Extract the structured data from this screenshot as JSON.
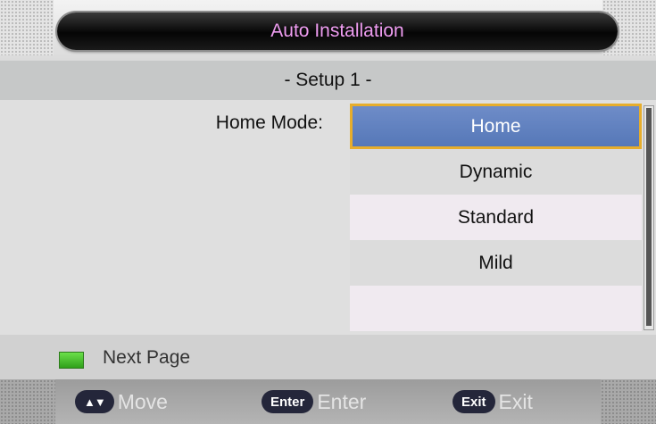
{
  "header": {
    "title": "Auto Installation"
  },
  "subtitle": "- Setup 1 -",
  "field": {
    "label": "Home Mode:"
  },
  "options": [
    {
      "label": "Home",
      "selected": true
    },
    {
      "label": "Dynamic",
      "selected": false
    },
    {
      "label": "Standard",
      "selected": false
    },
    {
      "label": "Mild",
      "selected": false
    },
    {
      "label": "",
      "selected": false
    }
  ],
  "footer_hint": {
    "key_color": "#3cc42a",
    "label": "Next Page"
  },
  "keys": [
    {
      "button": "▲▼",
      "label": "Move"
    },
    {
      "button": "Enter",
      "label": "Enter"
    },
    {
      "button": "Exit",
      "label": "Exit"
    }
  ]
}
